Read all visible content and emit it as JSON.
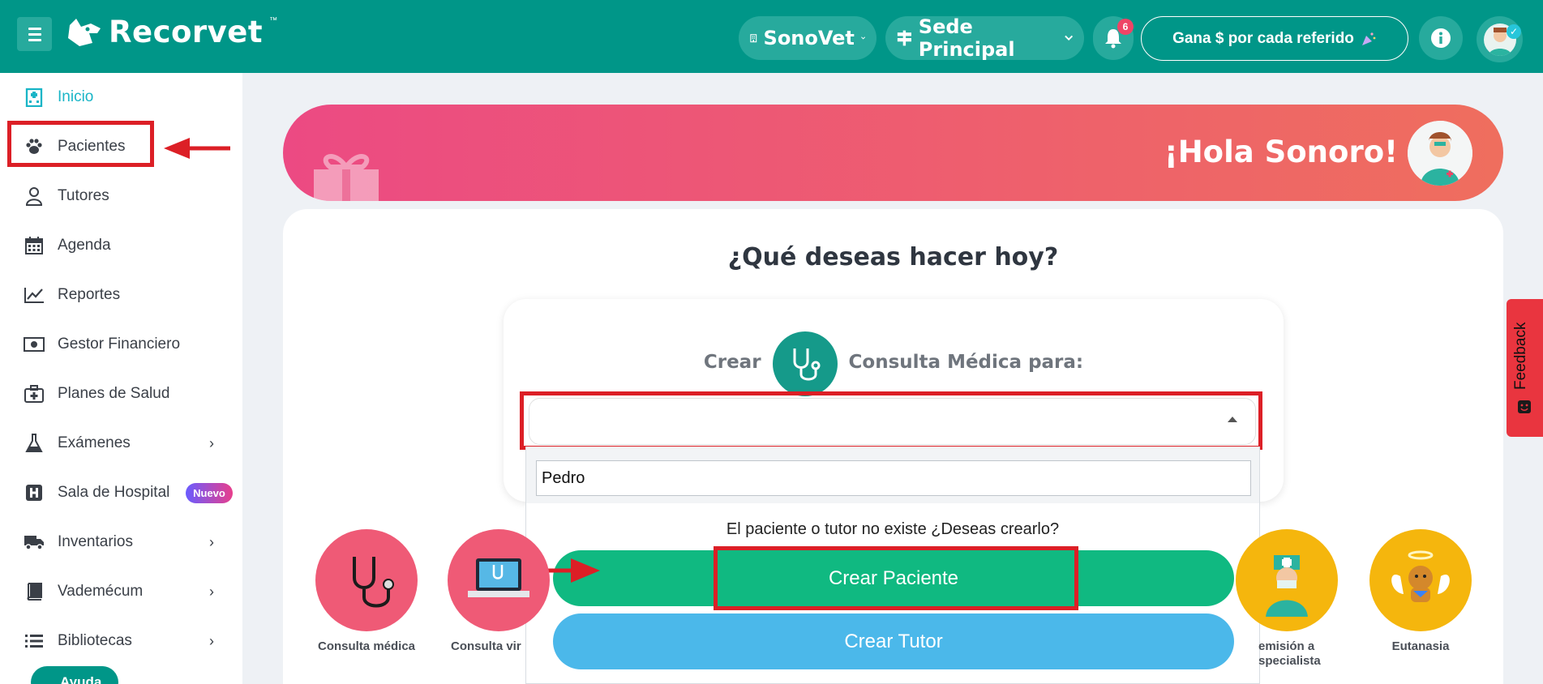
{
  "topbar": {
    "brand": "Recorvet",
    "brand_tm": "™",
    "clinic": "SonoVet",
    "branch": "Sede Principal",
    "notifications_count": "6",
    "referral": "Gana $ por cada referido"
  },
  "sidebar": {
    "items": [
      {
        "label": "Inicio",
        "icon": "hospital-icon"
      },
      {
        "label": "Pacientes",
        "icon": "paw-icon"
      },
      {
        "label": "Tutores",
        "icon": "user-icon"
      },
      {
        "label": "Agenda",
        "icon": "calendar-icon"
      },
      {
        "label": "Reportes",
        "icon": "chart-line-icon"
      },
      {
        "label": "Gestor Financiero",
        "icon": "money-bill-icon"
      },
      {
        "label": "Planes de Salud",
        "icon": "medkit-icon"
      },
      {
        "label": "Exámenes",
        "icon": "flask-icon"
      },
      {
        "label": "Sala de Hospital",
        "icon": "hospital-h-icon",
        "badge": "Nuevo"
      },
      {
        "label": "Inventarios",
        "icon": "truck-icon"
      },
      {
        "label": "Vademécum",
        "icon": "book-icon"
      },
      {
        "label": "Bibliotecas",
        "icon": "list-icon"
      }
    ],
    "help": "Ayuda"
  },
  "hero": {
    "greeting": "¡Hola Sonoro!"
  },
  "main": {
    "title": "¿Qué deseas hacer hoy?",
    "create_prefix": "Crear",
    "create_suffix": "Consulta Médica para:",
    "search_value": "Pedro",
    "not_found": "El paciente o tutor no existe ¿Deseas crearlo?",
    "btn_patient": "Crear Paciente",
    "btn_tutor": "Crear Tutor",
    "actions": [
      {
        "label": "Consulta médica"
      },
      {
        "label": "Consulta vir"
      },
      {
        "label": "emisión a\nspecialista"
      },
      {
        "label": "Eutanasia"
      }
    ]
  },
  "feedback": "Feedback",
  "colors": {
    "primary": "#009688",
    "accent_text": "#19b5c7",
    "annotation": "#dc1f26",
    "btn_patient": "#10b981",
    "btn_tutor": "#4bb8ea"
  }
}
